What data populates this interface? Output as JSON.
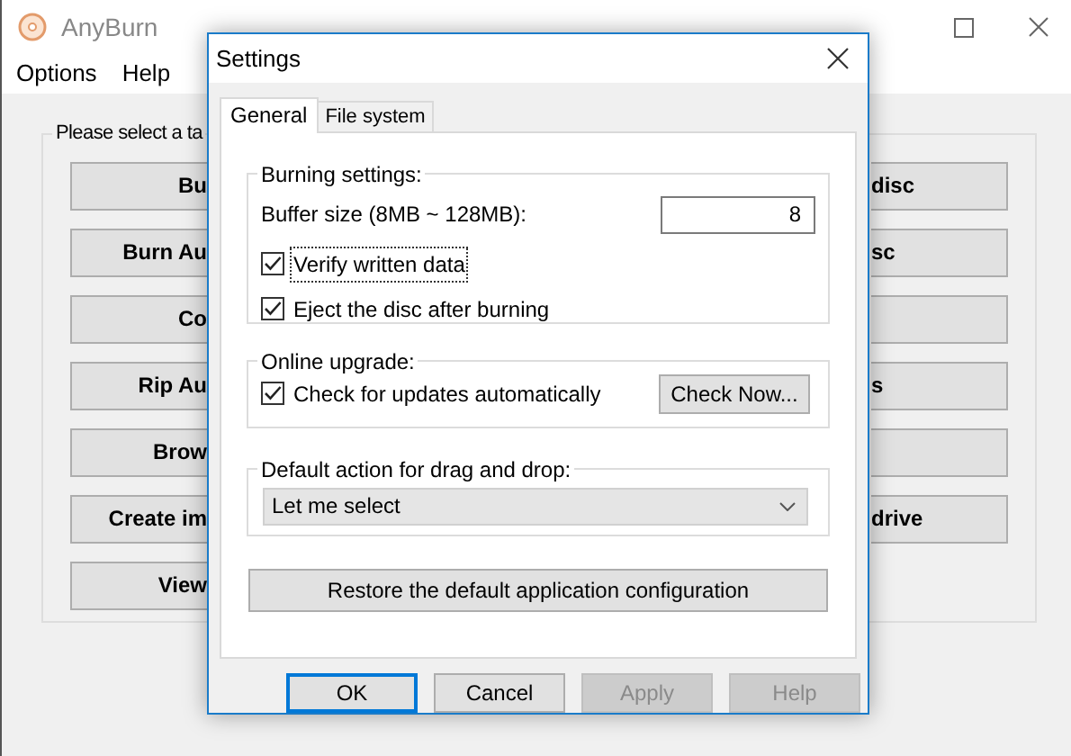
{
  "window": {
    "title": "AnyBurn"
  },
  "menu": [
    "Options",
    "Help"
  ],
  "task_group": {
    "label": "Please select a ta",
    "rows": [
      {
        "left": "Bu",
        "right_button": true,
        "right": "disc"
      },
      {
        "left": "Burn Au",
        "right_button": true,
        "right": "sc"
      },
      {
        "left": "Co",
        "right_button": true
      },
      {
        "left": "Rip Au",
        "right_button": true,
        "right": "s"
      },
      {
        "left": "Brow",
        "right_button": true
      },
      {
        "left": "Create im",
        "right_button": true,
        "right": "drive"
      },
      {
        "left": "View",
        "right_button": false
      }
    ]
  },
  "dialog": {
    "title": "Settings",
    "tabs": [
      {
        "label": "General",
        "selected": true
      },
      {
        "label": "File system",
        "selected": false
      }
    ],
    "burning": {
      "label": "Burning settings:",
      "buffer_label": "Buffer size (8MB ~ 128MB):",
      "buffer_value": "8",
      "checkboxes": [
        {
          "label": "Verify written data",
          "checked": true,
          "focused": true
        },
        {
          "label": "Eject the disc after burning",
          "checked": true,
          "focused": false
        }
      ]
    },
    "online": {
      "label": "Online upgrade:",
      "checkbox": {
        "label": "Check for updates automatically",
        "checked": true
      },
      "button": "Check Now..."
    },
    "drag_drop": {
      "label": "Default action for drag and drop:",
      "value": "Let me select"
    },
    "restore_button": "Restore the default application configuration",
    "buttons": [
      {
        "label": "OK",
        "disabled": false,
        "default": true
      },
      {
        "label": "Cancel",
        "disabled": false,
        "default": false
      },
      {
        "label": "Apply",
        "disabled": true,
        "default": false
      },
      {
        "label": "Help",
        "disabled": true,
        "default": false
      }
    ]
  }
}
